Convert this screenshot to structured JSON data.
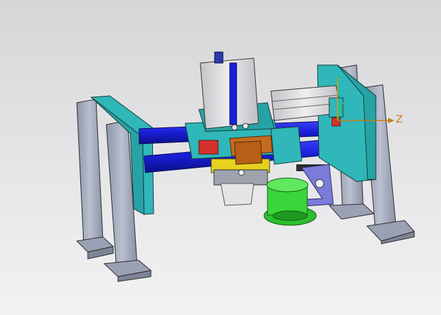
{
  "viewport": {
    "triad_axis_label": "Z",
    "colors": {
      "background_top": "#d6d6d8",
      "background_bottom": "#f2f2f3",
      "frame_plate": "#2fb7b9",
      "support_leg": "#a9b1c3",
      "guide_rod": "#1a1fd8",
      "cylinder_body": "#d9d9dd",
      "motor": "#38d63a",
      "bushing": "#c46a1d",
      "bracket": "#6a6ad0",
      "axis": "#c87d14"
    },
    "icons": [
      "coordinate-triad-icon"
    ]
  }
}
